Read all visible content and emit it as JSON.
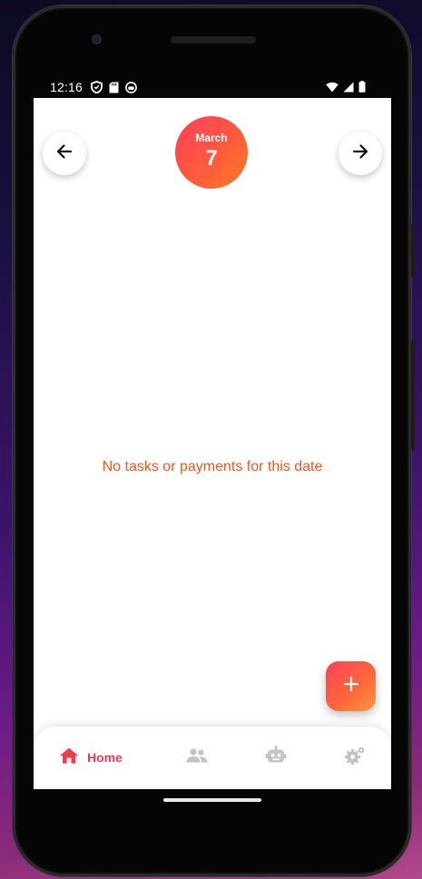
{
  "status_bar": {
    "time": "12:16",
    "left_icons": [
      "shield-icon",
      "sd-card-icon",
      "sync-icon"
    ],
    "right_icons": [
      "wifi-icon",
      "signal-icon",
      "battery-icon"
    ]
  },
  "header": {
    "prev_icon": "arrow-left-icon",
    "next_icon": "arrow-right-icon",
    "date": {
      "month": "March",
      "day": "7"
    }
  },
  "main": {
    "empty_message": "No tasks or payments for this date"
  },
  "fab": {
    "icon": "plus-icon"
  },
  "bottom_nav": {
    "items": [
      {
        "icon": "home-icon",
        "label": "Home",
        "active": true
      },
      {
        "icon": "people-icon",
        "label": "",
        "active": false
      },
      {
        "icon": "robot-icon",
        "label": "",
        "active": false
      },
      {
        "icon": "settings-icon",
        "label": "",
        "active": false
      }
    ]
  },
  "colors": {
    "accent": "#ef3b4e",
    "gradient_start": "#ff3f5a",
    "gradient_end": "#ff7a22",
    "empty_text": "#e65a22",
    "inactive_icon": "#c4c4c4"
  }
}
